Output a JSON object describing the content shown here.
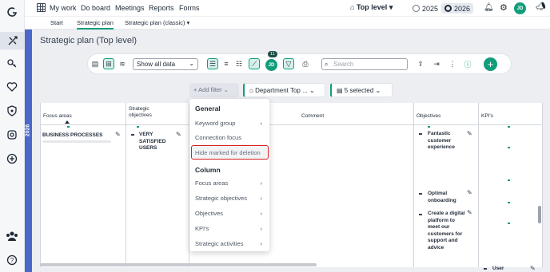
{
  "app": {
    "year_label": "2026"
  },
  "topnav": {
    "items": [
      "My work",
      "Do board",
      "Meetings",
      "Reports",
      "Forms"
    ],
    "level": "Top level",
    "years": [
      "2025",
      "2026"
    ],
    "user_initials": "JD"
  },
  "subtabs": [
    "Start",
    "Strategic plan",
    "Strategic plan (classic)"
  ],
  "page": {
    "title": "Strategic plan (Top level)"
  },
  "toolbar": {
    "view_select": "Show all data",
    "search_placeholder": "Search",
    "badge_count": "11",
    "avatar_initials": "JD"
  },
  "filters": {
    "add_filter": "+ Add filter",
    "department_chip": "Department Top ...",
    "columns_chip": "5 selected"
  },
  "table": {
    "headers": [
      "Focus areas",
      "Strategic objectives",
      "Comment",
      "Objectives",
      "KPI's"
    ],
    "focus_area": "BUSINESS PROCESSES",
    "strategic_objective": "VERY SATISFIED USERS",
    "objectives": [
      "Fantastic customer experience",
      "Optimal onboarding",
      "Create a digital platform to meet our customers for support and advice"
    ],
    "kpi": "User satisfaction"
  },
  "menu": {
    "general_heading": "General",
    "general_items": [
      "Keyword group",
      "Connection focus",
      "Hide marked for deletion"
    ],
    "column_heading": "Column",
    "column_items": [
      "Focus areas",
      "Strategic objectives",
      "Objectives",
      "KPI's",
      "Strategic activities"
    ]
  }
}
